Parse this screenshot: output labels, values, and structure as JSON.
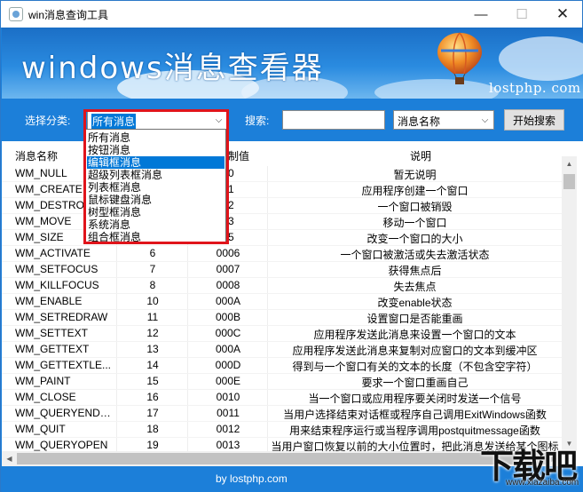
{
  "window": {
    "title": "win消息查询工具",
    "min": "—",
    "max": "☐",
    "close": "✕"
  },
  "banner": {
    "title": "windows消息查看器",
    "url": "lostphp. com"
  },
  "toolbar": {
    "category_label": "选择分类:",
    "category_value": "所有消息",
    "search_label": "搜索:",
    "search_value": "",
    "field_value": "消息名称",
    "start_button": "开始搜索"
  },
  "dropdown": {
    "options": [
      "所有消息",
      "按钮消息",
      "编辑框消息",
      "超级列表框消息",
      "列表框消息",
      "鼠标键盘消息",
      "树型框消息",
      "系统消息",
      "组合框消息"
    ],
    "selected_index": 2
  },
  "table": {
    "headers": [
      "消息名称",
      "",
      "十六进制值",
      "说明"
    ],
    "header_hex_visible": "制值",
    "rows": [
      {
        "name": "WM_NULL",
        "dec": "",
        "hex": "00",
        "desc": "暂无说明"
      },
      {
        "name": "WM_CREATE",
        "dec": "",
        "hex": "01",
        "desc": "应用程序创建一个窗口"
      },
      {
        "name": "WM_DESTROY",
        "dec": "",
        "hex": "02",
        "desc": "一个窗口被销毁"
      },
      {
        "name": "WM_MOVE",
        "dec": "",
        "hex": "03",
        "desc": "移动一个窗口"
      },
      {
        "name": "WM_SIZE",
        "dec": "",
        "hex": "05",
        "desc": "改变一个窗口的大小"
      },
      {
        "name": "WM_ACTIVATE",
        "dec": "6",
        "hex": "0006",
        "desc": "一个窗口被激活或失去激活状态"
      },
      {
        "name": "WM_SETFOCUS",
        "dec": "7",
        "hex": "0007",
        "desc": "获得焦点后"
      },
      {
        "name": "WM_KILLFOCUS",
        "dec": "8",
        "hex": "0008",
        "desc": "失去焦点"
      },
      {
        "name": "WM_ENABLE",
        "dec": "10",
        "hex": "000A",
        "desc": "改变enable状态"
      },
      {
        "name": "WM_SETREDRAW",
        "dec": "11",
        "hex": "000B",
        "desc": "设置窗口是否能重画"
      },
      {
        "name": "WM_SETTEXT",
        "dec": "12",
        "hex": "000C",
        "desc": "应用程序发送此消息来设置一个窗口的文本"
      },
      {
        "name": "WM_GETTEXT",
        "dec": "13",
        "hex": "000A",
        "desc": "应用程序发送此消息来复制对应窗口的文本到缓冲区"
      },
      {
        "name": "WM_GETTEXTLE...",
        "dec": "14",
        "hex": "000D",
        "desc": "得到与一个窗口有关的文本的长度（不包含空字符）"
      },
      {
        "name": "WM_PAINT",
        "dec": "15",
        "hex": "000E",
        "desc": "要求一个窗口重画自己"
      },
      {
        "name": "WM_CLOSE",
        "dec": "16",
        "hex": "0010",
        "desc": "当一个窗口或应用程序要关闭时发送一个信号"
      },
      {
        "name": "WM_QUERYENDS...",
        "dec": "17",
        "hex": "0011",
        "desc": "当用户选择结束对话框或程序自己调用ExitWindows函数"
      },
      {
        "name": "WM_QUIT",
        "dec": "18",
        "hex": "0012",
        "desc": "用来结束程序运行或当程序调用postquitmessage函数"
      },
      {
        "name": "WM_QUERYOPEN",
        "dec": "19",
        "hex": "0013",
        "desc": "当用户窗口恢复以前的大小位置时，把此消息发送给某个图标"
      }
    ]
  },
  "footer": {
    "text": "by lostphp.com"
  },
  "watermark": {
    "big": "下载吧",
    "small": "www.xiazaiba.com"
  },
  "colors": {
    "accent": "#1c7fd9",
    "selection": "#0078d7",
    "highlight_frame": "#e0141b"
  }
}
